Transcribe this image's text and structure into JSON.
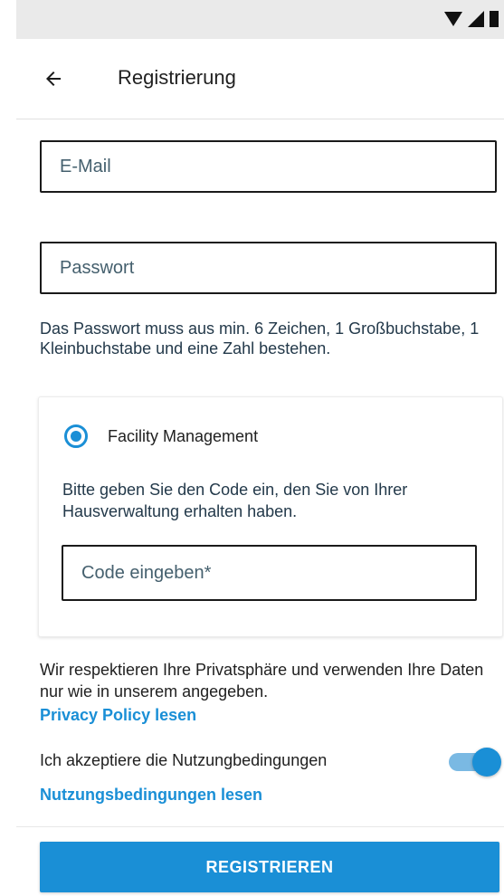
{
  "status_bar": {
    "icons": [
      "wifi-icon",
      "signal-icon",
      "battery-icon"
    ]
  },
  "app_bar": {
    "back_icon": "arrow-left-icon",
    "title": "Registrierung"
  },
  "form": {
    "email_placeholder": "E-Mail",
    "password_placeholder": "Passwort",
    "password_hint": "Das Passwort muss aus min. 6 Zeichen, 1 Großbuchstabe, 1 Kleinbuchstabe und eine Zahl bestehen."
  },
  "facility": {
    "radio_label": "Facility Management",
    "radio_selected": true,
    "instruction": "Bitte geben Sie den Code ein, den Sie von Ihrer Hausverwaltung erhalten haben.",
    "code_placeholder": "Code eingeben*"
  },
  "privacy": {
    "text": "Wir respektieren Ihre Privatsphäre und verwenden Ihre Daten nur wie in unserem angegeben.",
    "link": "Privacy Policy lesen"
  },
  "terms": {
    "label": "Ich akzeptiere die Nutzungbedingungen",
    "accepted": true,
    "link": "Nutzungsbedingungen lesen"
  },
  "actions": {
    "register_label": "REGISTRIEREN"
  },
  "colors": {
    "accent": "#1a8fd6",
    "toggle_track": "#7ab9e3",
    "status_bar": "#eaeaea"
  }
}
